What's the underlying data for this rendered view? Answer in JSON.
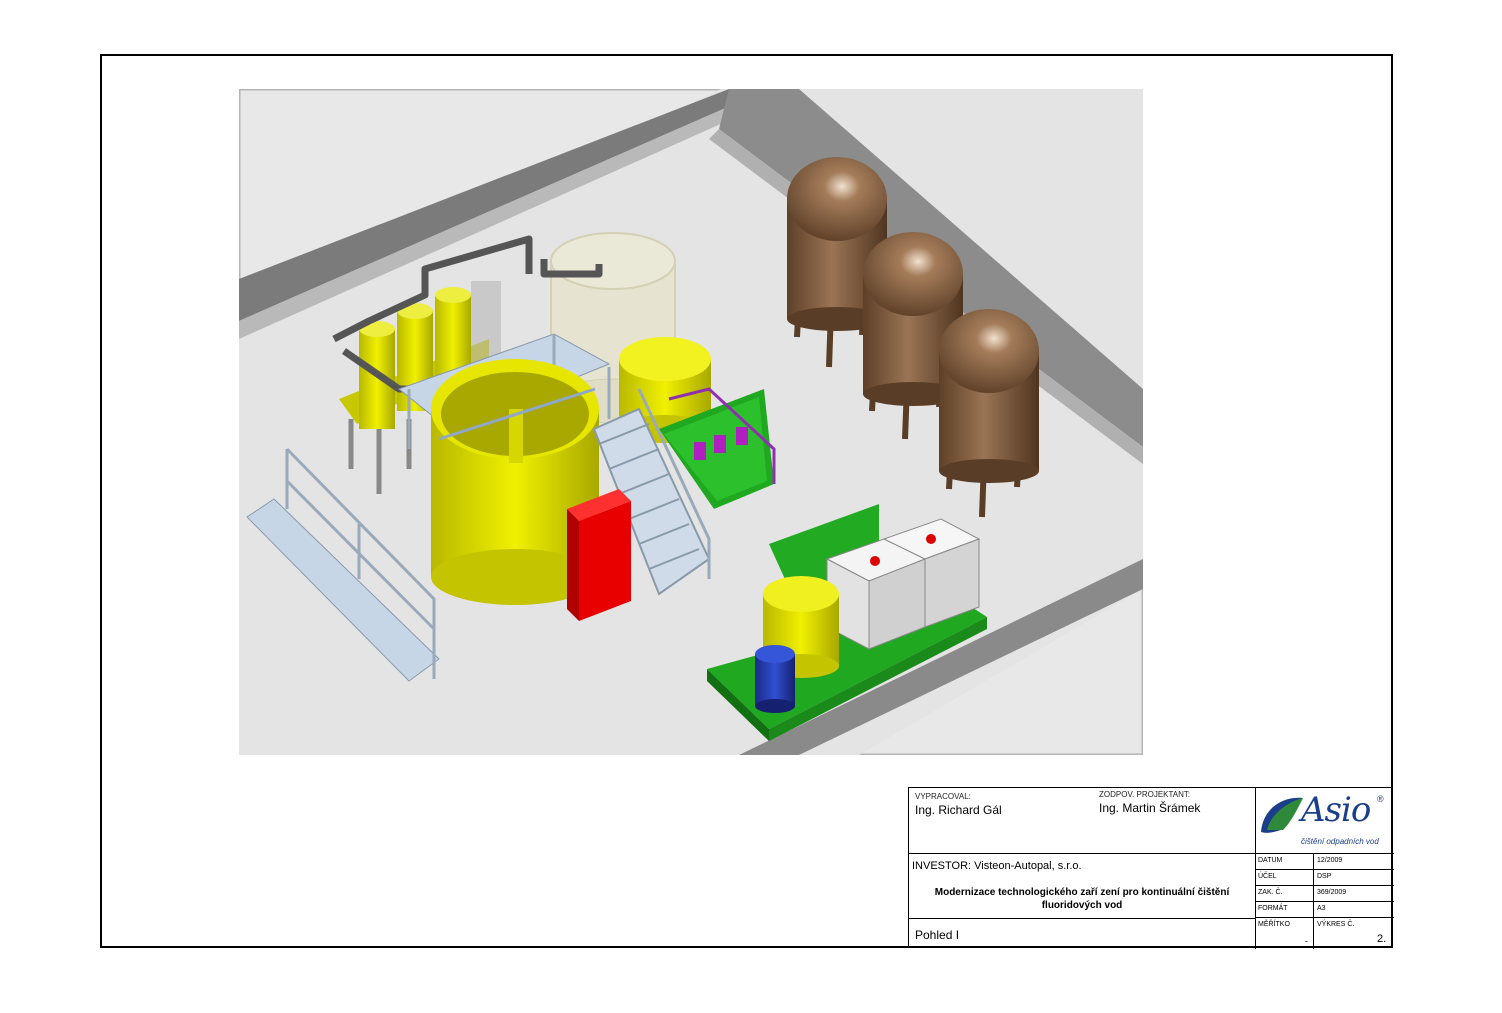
{
  "title_block": {
    "vypracoval_label": "VYPRACOVAL:",
    "vypracoval": "Ing. Richard Gál",
    "zodpov_label": "ZODPOV. PROJEKTANT:",
    "zodpov": "Ing. Martin Šrámek",
    "investor_label": "INVESTOR:",
    "investor": "Visteon-Autopal, s.r.o.",
    "project_line1": "Modernizace technologického zaří zení pro kontinuální čištění",
    "project_line2": "fluoridových vod",
    "view_name": "Pohled I",
    "datum_label": "DATUM",
    "datum": "12/2009",
    "ucel_label": "ÚČEL",
    "ucel": "DSP",
    "zak_label": "ZAK. Č.",
    "zak": "369/2009",
    "format_label": "FORMÁT",
    "format": "A3",
    "meritko_label": "MĚŘÍTKO",
    "meritko": "-",
    "vykres_label": "VÝKRES Č.",
    "vykres": "2."
  },
  "logo": {
    "name": "Asio",
    "tagline": "čištění odpadních vod",
    "mark": "®"
  },
  "colors": {
    "yellow": "#d8d800",
    "brown": "#7a5a3a",
    "green": "#22aa22",
    "red": "#dd0000",
    "floor": "#e6e6e6",
    "wall": "#7d7d7d"
  }
}
